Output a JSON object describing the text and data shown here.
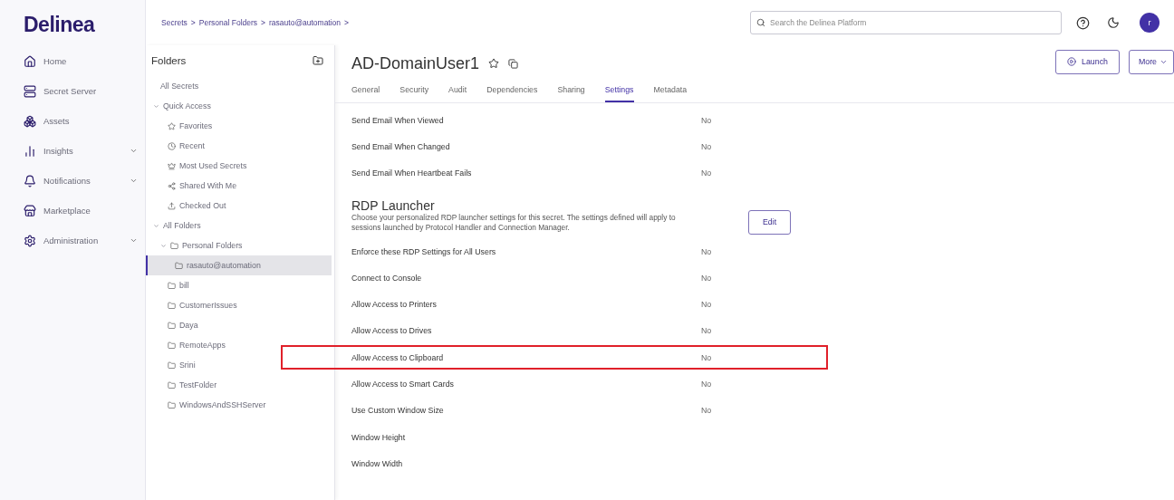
{
  "logo": "Delinea",
  "nav": [
    {
      "label": "Home",
      "kind": "home",
      "submenu": false
    },
    {
      "label": "Secret Server",
      "kind": "server",
      "submenu": false
    },
    {
      "label": "Assets",
      "kind": "assets",
      "submenu": false
    },
    {
      "label": "Insights",
      "kind": "insights",
      "submenu": true
    },
    {
      "label": "Notifications",
      "kind": "notifications",
      "submenu": true
    },
    {
      "label": "Marketplace",
      "kind": "marketplace",
      "submenu": false
    },
    {
      "label": "Administration",
      "kind": "admin",
      "submenu": true
    }
  ],
  "breadcrumb": [
    "Secrets",
    "Personal Folders",
    "rasauto@automation"
  ],
  "breadcrumb_separator": ">",
  "search": {
    "placeholder": "Search the Delinea Platform"
  },
  "avatar": "r",
  "folders": {
    "title": "Folders",
    "items": [
      {
        "label": "All Secrets",
        "selected": false
      },
      {
        "label": "Quick Access",
        "selected": false,
        "expanded": true,
        "children": [
          {
            "label": "Favorites",
            "kind": "favorites",
            "selected": false
          },
          {
            "label": "Recent",
            "kind": "recent",
            "selected": false
          },
          {
            "label": "Most Used Secrets",
            "kind": "popular",
            "selected": false
          },
          {
            "label": "Shared With Me",
            "kind": "shared",
            "selected": false
          },
          {
            "label": "Checked Out",
            "kind": "checkedout",
            "selected": false
          }
        ]
      },
      {
        "label": "All Folders",
        "selected": false,
        "expanded": true,
        "children": [
          {
            "label": "Personal Folders",
            "kind": "folder",
            "selected": false,
            "expanded": true,
            "children": [
              {
                "label": "rasauto@automation",
                "kind": "folder",
                "selected": true
              }
            ]
          },
          {
            "label": "bill",
            "kind": "folder",
            "selected": false
          },
          {
            "label": "CustomerIssues",
            "kind": "folder",
            "selected": false
          },
          {
            "label": "Daya",
            "kind": "folder",
            "selected": false
          },
          {
            "label": "RemoteApps",
            "kind": "folder",
            "selected": false
          },
          {
            "label": "Srini",
            "kind": "folder",
            "selected": false
          },
          {
            "label": "TestFolder",
            "kind": "folder",
            "selected": false
          },
          {
            "label": "WindowsAndSSHServer",
            "kind": "folder",
            "selected": false
          }
        ]
      }
    ]
  },
  "secret": {
    "title": "AD-DomainUser1",
    "buttons": [
      "Launch",
      "More"
    ]
  },
  "tabs": [
    {
      "label": "General",
      "selected": false
    },
    {
      "label": "Security",
      "selected": false
    },
    {
      "label": "Audit",
      "selected": false
    },
    {
      "label": "Dependencies",
      "selected": false
    },
    {
      "label": "Sharing",
      "selected": false
    },
    {
      "label": "Settings",
      "selected": true
    },
    {
      "label": "Metadata",
      "selected": false
    }
  ],
  "email_settings": [
    {
      "label": "Send Email When Viewed",
      "value": "No",
      "highlighted": false
    },
    {
      "label": "Send Email When Changed",
      "value": "No",
      "highlighted": false
    },
    {
      "label": "Send Email When Heartbeat Fails",
      "value": "No",
      "highlighted": false
    }
  ],
  "rdp": {
    "title": "RDP Launcher",
    "description": "Choose your personalized RDP launcher settings for this secret. The settings defined will apply to sessions launched by Protocol Handler and Connection Manager.",
    "button": "Edit",
    "settings": [
      {
        "label": "Enforce these RDP Settings for All Users",
        "value": "No",
        "highlighted": false
      },
      {
        "label": "Connect to Console",
        "value": "No",
        "highlighted": false
      },
      {
        "label": "Allow Access to Printers",
        "value": "No",
        "highlighted": false
      },
      {
        "label": "Allow Access to Drives",
        "value": "No",
        "highlighted": false
      },
      {
        "label": "Allow Access to Clipboard",
        "value": "No",
        "highlighted": true
      },
      {
        "label": "Allow Access to Smart Cards",
        "value": "No",
        "highlighted": false
      },
      {
        "label": "Use Custom Window Size",
        "value": "No",
        "highlighted": false
      },
      {
        "label": "Window Height",
        "highlighted": false
      },
      {
        "label": "Window Width",
        "highlighted": false
      }
    ]
  }
}
